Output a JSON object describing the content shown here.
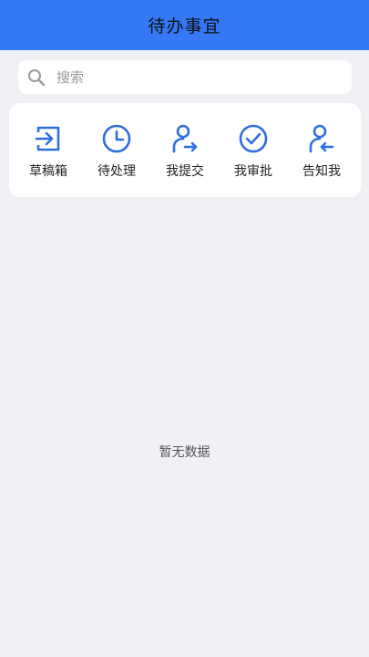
{
  "header": {
    "title": "待办事宜"
  },
  "search": {
    "placeholder": "搜索",
    "icon": "search-icon"
  },
  "quick_actions": [
    {
      "label": "草稿箱",
      "icon": "drafts-icon"
    },
    {
      "label": "待处理",
      "icon": "clock-icon"
    },
    {
      "label": "我提交",
      "icon": "user-submit-icon"
    },
    {
      "label": "我审批",
      "icon": "check-circle-icon"
    },
    {
      "label": "告知我",
      "icon": "user-notify-icon"
    }
  ],
  "empty": {
    "text": "暂无数据"
  },
  "colors": {
    "header": "#3478f6",
    "accent_icon": "#2f6fe0",
    "background": "#f0f1f5"
  }
}
